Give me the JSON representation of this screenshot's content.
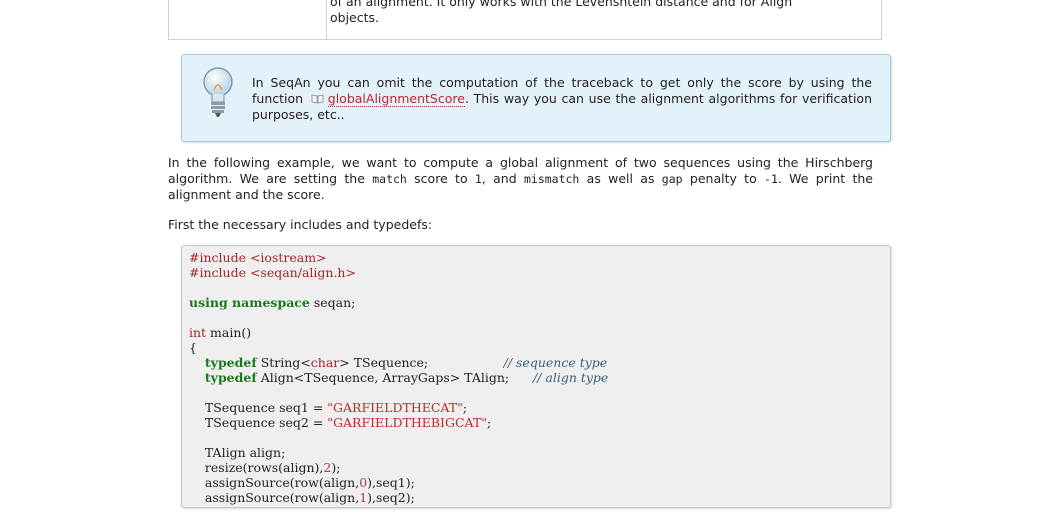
{
  "table_fragment": {
    "line1": "of an alignment. It only works with the Levenshtein distance and for Align",
    "line2": "objects."
  },
  "tip": {
    "text_before": "In SeqAn you can omit the computation of the traceback to get only the score by using the function",
    "link": "globalAlignmentScore",
    "text_after": ". This way you can use the alignment algorithms for verification purposes, etc..",
    "icon": "lightbulb-icon",
    "link_icon": "book-icon",
    "colors": {
      "background": "#e2f1fa",
      "border": "#9fc9de",
      "link": "#c0282d"
    }
  },
  "paragraph1": {
    "a": "In the following example, we want to compute a global alignment of two sequences using the Hirschberg algorithm. We are setting the",
    "code1": "match",
    "b": "score to",
    "code2": "1",
    "c": ", and",
    "code3": "mismatch",
    "d": "as well as",
    "code4": "gap",
    "e": "penalty to",
    "code5": "-1",
    "f": ". We print the alignment and the score."
  },
  "paragraph2": "First the necessary includes and typedefs:",
  "code": {
    "include1": "#include <iostream>",
    "include2": "#include <seqan/align.h>",
    "using_kw": "using namespace",
    "using_rest": " seqan;",
    "int_kw": "int",
    "main_rest": " main()",
    "brace": "{",
    "typedef_kw": "typedef",
    "t1_a": " String<",
    "t1_char": "char",
    "t1_b": "> TSequence;",
    "comment1": "// sequence type",
    "t2_rest": " Align<TSequence, ArrayGaps> TAlign;",
    "comment2": "// align type",
    "seq1_a": "TSequence seq1 = ",
    "seq1_str": "\"GARFIELDTHECAT\"",
    "seq2_a": "TSequence seq2 = ",
    "seq2_str": "\"GARFIELDTHEBIGCAT\"",
    "semi": ";",
    "talign": "TAlign align;",
    "resize_a": "resize(rows(align),",
    "two": "2",
    "resize_b": ");",
    "as1_a": "assignSource(row(align,",
    "zero": "0",
    "as1_b": "),seq1);",
    "as2_a": "assignSource(row(align,",
    "one": "1",
    "as2_b": "),seq2);"
  }
}
